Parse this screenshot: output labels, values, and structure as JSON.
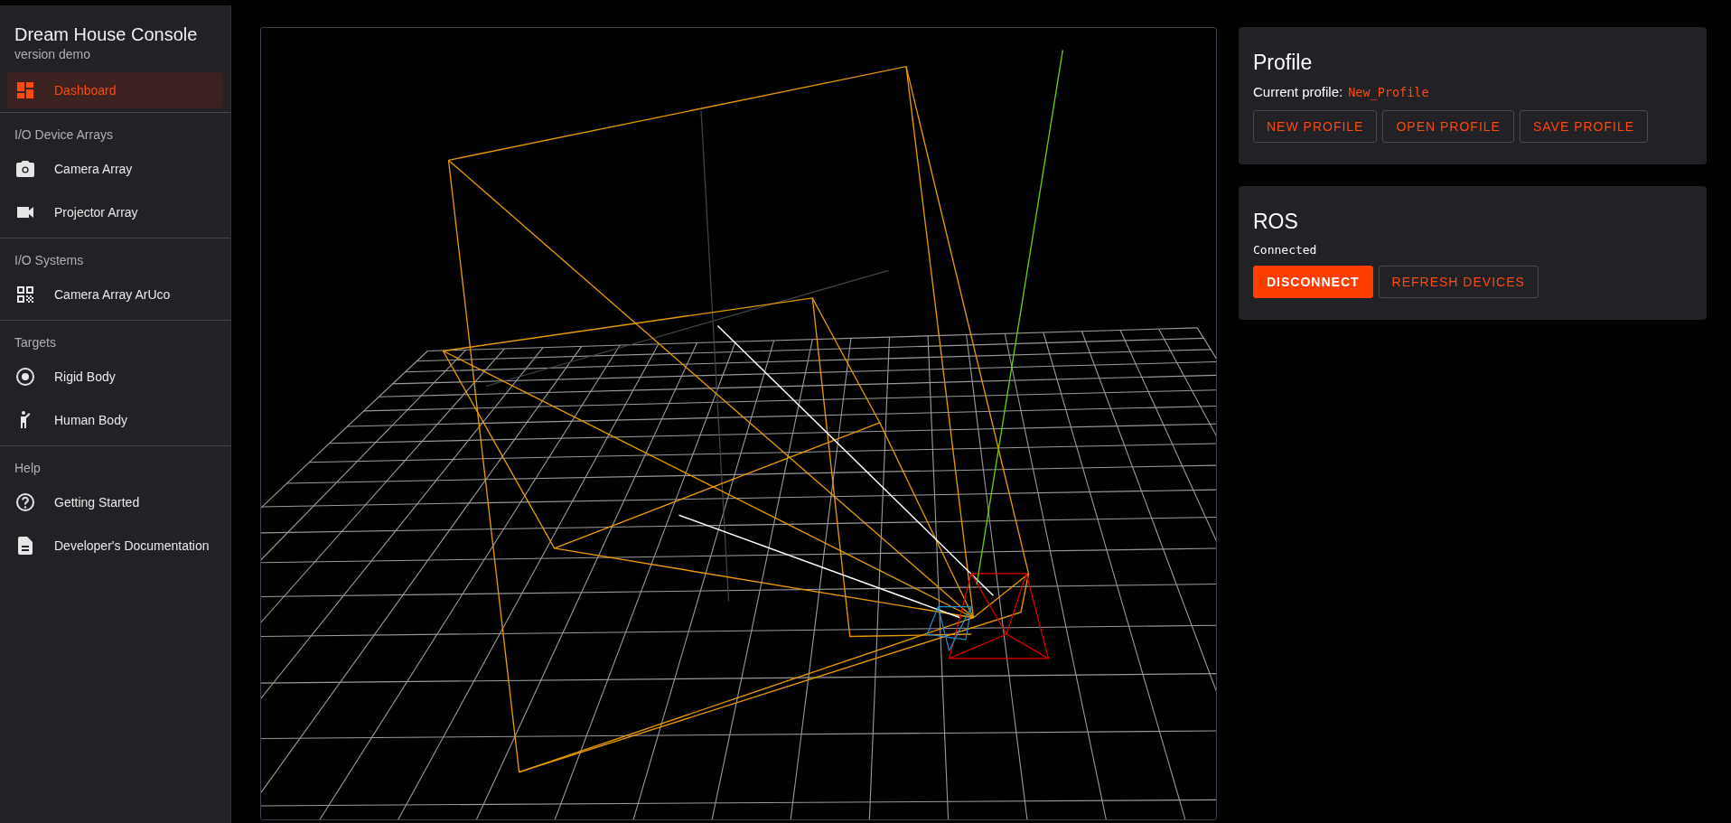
{
  "app": {
    "title": "Dream House Console",
    "subtitle": "version demo"
  },
  "sidebar": {
    "sections": [
      {
        "items": [
          {
            "label": "Dashboard",
            "kind": "dashboard",
            "selected": true
          }
        ]
      },
      {
        "heading": "I/O Device Arrays",
        "items": [
          {
            "label": "Camera Array",
            "kind": "camera",
            "selected": false
          },
          {
            "label": "Projector Array",
            "kind": "video",
            "selected": false
          }
        ]
      },
      {
        "heading": "I/O Systems",
        "items": [
          {
            "label": "Camera Array ArUco",
            "kind": "qr",
            "selected": false
          }
        ]
      },
      {
        "heading": "Targets",
        "items": [
          {
            "label": "Rigid Body",
            "kind": "target",
            "selected": false
          },
          {
            "label": "Human Body",
            "kind": "person",
            "selected": false
          }
        ]
      },
      {
        "heading": "Help",
        "items": [
          {
            "label": "Getting Started",
            "kind": "help",
            "selected": false
          },
          {
            "label": "Developer's Documentation",
            "kind": "document",
            "selected": false
          }
        ]
      }
    ]
  },
  "profile": {
    "title": "Profile",
    "current_label": "Current profile:",
    "current_value": "New_Profile",
    "buttons": [
      {
        "label": "NEW PROFILE",
        "kind": "outlined"
      },
      {
        "label": "OPEN PROFILE",
        "kind": "outlined"
      },
      {
        "label": "SAVE PROFILE",
        "kind": "outlined"
      }
    ]
  },
  "ros": {
    "title": "ROS",
    "status": "Connected",
    "buttons": [
      {
        "label": "DISCONNECT",
        "kind": "filled"
      },
      {
        "label": "REFRESH DEVICES",
        "kind": "outlined"
      }
    ]
  }
}
